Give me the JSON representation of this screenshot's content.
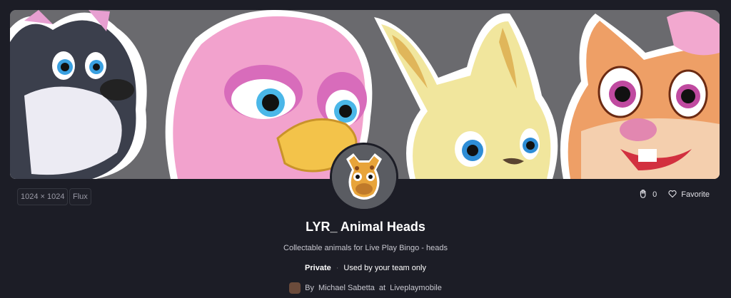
{
  "meta": {
    "dimensions": "1024 × 1024",
    "model": "Flux"
  },
  "actions": {
    "likes_count": "0",
    "favorite_label": "Favorite",
    "like_icon": "hand-heart-icon",
    "favorite_icon": "heart-outline-icon"
  },
  "project": {
    "title": "LYR_ Animal Heads",
    "description": "Collectable animals for Live Play Bingo - heads",
    "visibility": "Private",
    "visibility_note": "Used by your team only",
    "author_prefix": "By",
    "author_name": "Michael Sabetta",
    "author_at": "at",
    "team": "Liveplaymobile"
  },
  "colors": {
    "background": "#1c1d26",
    "banner_bg": "#6a6a6e"
  }
}
